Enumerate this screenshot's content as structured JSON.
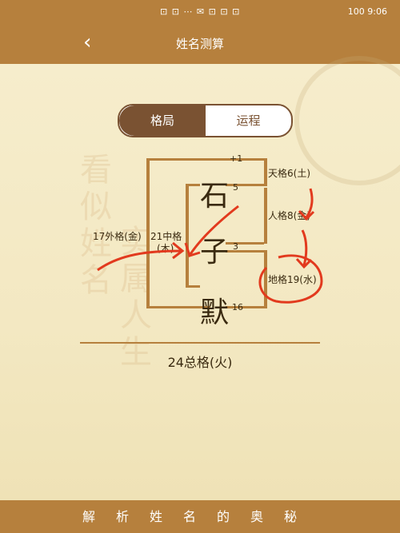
{
  "statusbar": {
    "left_text": "⊡ ⊡ ⋯ ✉ ⊡ ⊡ ⊡",
    "time": "9:06",
    "battery": "100"
  },
  "navbar": {
    "back_label": "‹",
    "title": "姓名测算"
  },
  "tabs": {
    "active": "格局",
    "inactive": "运程"
  },
  "name": {
    "chars": [
      "石",
      "子",
      "默"
    ]
  },
  "numbers": {
    "top": "+1",
    "c1": "5",
    "c2": "3",
    "c3": "16"
  },
  "labels": {
    "tian": "天格6(土)",
    "ren": "人格8(金)",
    "di": "地格19(水)",
    "wai": "17外格(金)",
    "zhong_l1": "21中格",
    "zhong_l2": "(木)",
    "zong": "24总格(火)"
  },
  "footer": {
    "text": "解析姓名的奥秘"
  },
  "colors": {
    "brand": "#b6803d",
    "accent": "#7a5232",
    "annotation": "#e23a1e"
  }
}
